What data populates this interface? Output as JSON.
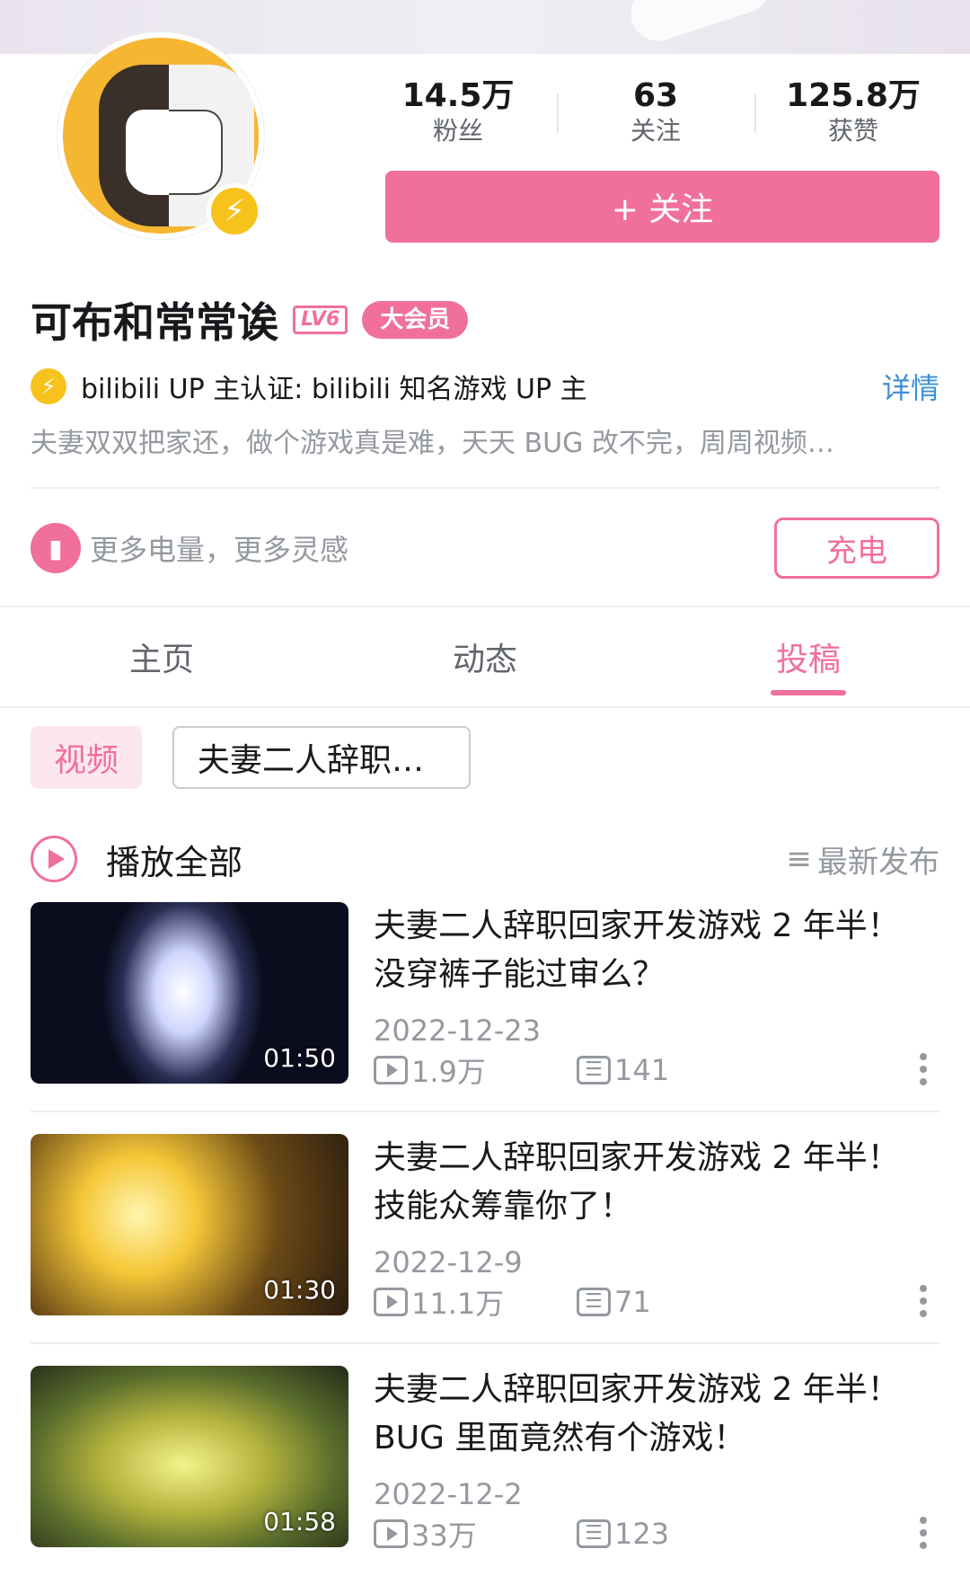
{
  "profile": {
    "name": "可布和常常诶",
    "level_badge": "LV6",
    "vip_badge": "大会员",
    "stats": [
      {
        "value": "14.5万",
        "label": "粉丝"
      },
      {
        "value": "63",
        "label": "关注"
      },
      {
        "value": "125.8万",
        "label": "获赞"
      }
    ],
    "follow_label": "+ 关注",
    "certification": "bilibili UP 主认证: bilibili 知名游戏 UP 主",
    "detail_link": "详情",
    "description": "夫妻双双把家还，做个游戏真是难，天天 BUG 改不完，周周视频…"
  },
  "charge": {
    "text": "更多电量，更多灵感",
    "button": "充电"
  },
  "tabs": [
    {
      "label": "主页",
      "active": false
    },
    {
      "label": "动态",
      "active": false
    },
    {
      "label": "投稿",
      "active": true
    }
  ],
  "filters": {
    "video_chip": "视频",
    "series_chip": "夫妻二人辞职…"
  },
  "list_header": {
    "play_all": "播放全部",
    "sort_icon": "≡",
    "sort_label": "最新发布"
  },
  "videos": [
    {
      "title": "夫妻二人辞职回家开发游戏 2 年半！没穿裤子能过审么？",
      "date": "2022-12-23",
      "views": "1.9万",
      "comments": "141",
      "duration": "01:50"
    },
    {
      "title": "夫妻二人辞职回家开发游戏 2 年半！技能众筹靠你了！",
      "date": "2022-12-9",
      "views": "11.1万",
      "comments": "71",
      "duration": "01:30"
    },
    {
      "title": "夫妻二人辞职回家开发游戏 2 年半！BUG 里面竟然有个游戏！",
      "date": "2022-12-2",
      "views": "33万",
      "comments": "123",
      "duration": "01:58"
    }
  ],
  "colors": {
    "accent": "#f0709a",
    "link": "#3f8fd8",
    "gold": "#f8c21c"
  }
}
